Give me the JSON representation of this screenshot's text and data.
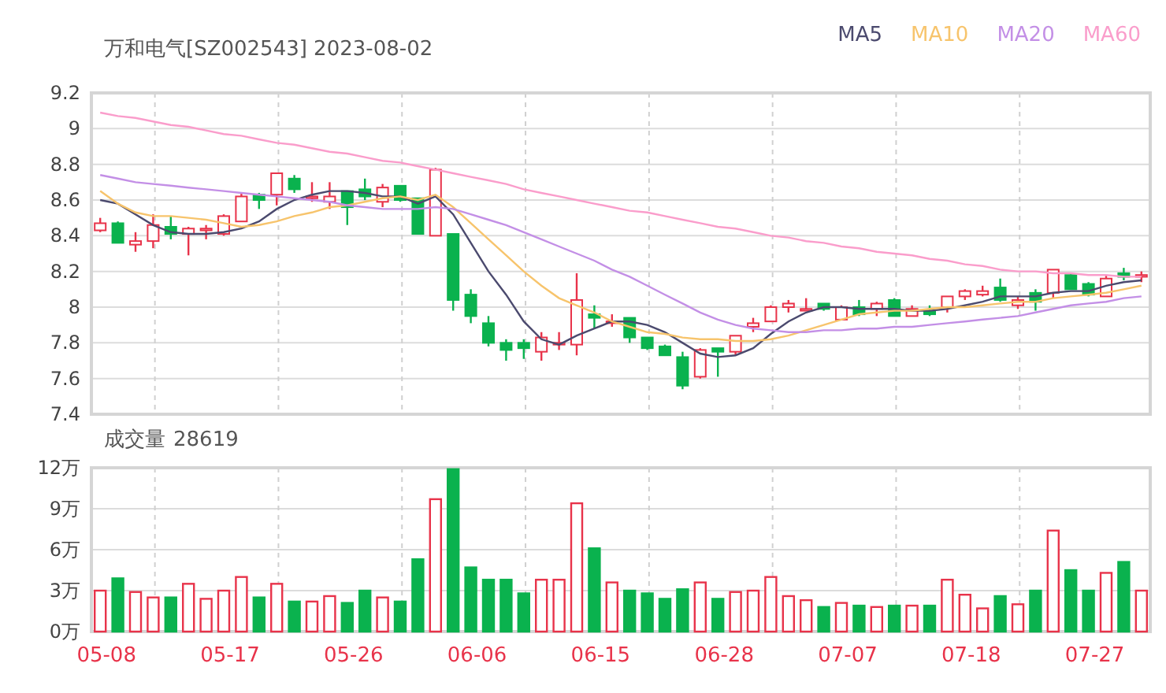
{
  "header": {
    "title": "万和电气[SZ002543] 2023-08-02"
  },
  "price_chart": {
    "chart_data": {
      "type": "line",
      "grid": true,
      "ylim": [
        7.4,
        9.2
      ],
      "yticks": [
        7.4,
        7.6,
        7.8,
        8,
        8.2,
        8.4,
        8.6,
        8.8,
        9,
        9.2
      ],
      "series": [
        {
          "name": "MA5",
          "color": "#4b4a6e",
          "values": [
            8.6,
            8.58,
            8.52,
            8.46,
            8.42,
            8.41,
            8.41,
            8.42,
            8.44,
            8.48,
            8.55,
            8.6,
            8.63,
            8.65,
            8.65,
            8.64,
            8.62,
            8.62,
            8.58,
            8.62,
            8.52,
            8.36,
            8.2,
            8.07,
            7.92,
            7.82,
            7.79,
            7.84,
            7.88,
            7.92,
            7.92,
            7.9,
            7.86,
            7.8,
            7.74,
            7.72,
            7.73,
            7.77,
            7.85,
            7.92,
            7.97,
            8,
            8,
            7.99,
            7.99,
            7.99,
            7.98,
            7.98,
            7.99,
            8.01,
            8.03,
            8.06,
            8.06,
            8.06,
            8.08,
            8.09,
            8.09,
            8.12,
            8.14,
            8.15
          ]
        },
        {
          "name": "MA10",
          "color": "#f7c46c",
          "values": [
            8.65,
            8.58,
            8.53,
            8.51,
            8.51,
            8.5,
            8.49,
            8.47,
            8.45,
            8.46,
            8.48,
            8.51,
            8.53,
            8.56,
            8.57,
            8.59,
            8.61,
            8.62,
            8.6,
            8.63,
            8.56,
            8.47,
            8.38,
            8.29,
            8.2,
            8.12,
            8.05,
            8.01,
            7.97,
            7.92,
            7.89,
            7.86,
            7.85,
            7.83,
            7.82,
            7.82,
            7.81,
            7.81,
            7.82,
            7.84,
            7.87,
            7.9,
            7.93,
            7.96,
            7.97,
            7.98,
            7.98,
            7.99,
            8,
            8,
            8.01,
            8.02,
            8.03,
            8.03,
            8.05,
            8.06,
            8.07,
            8.08,
            8.1,
            8.12
          ]
        },
        {
          "name": "MA20",
          "color": "#c38fe6",
          "values": [
            8.74,
            8.72,
            8.7,
            8.69,
            8.68,
            8.67,
            8.66,
            8.65,
            8.64,
            8.63,
            8.62,
            8.61,
            8.6,
            8.59,
            8.57,
            8.56,
            8.55,
            8.55,
            8.55,
            8.56,
            8.55,
            8.52,
            8.49,
            8.46,
            8.42,
            8.38,
            8.34,
            8.3,
            8.26,
            8.21,
            8.17,
            8.12,
            8.07,
            8.02,
            7.97,
            7.93,
            7.9,
            7.88,
            7.87,
            7.86,
            7.86,
            7.87,
            7.87,
            7.88,
            7.88,
            7.89,
            7.89,
            7.9,
            7.91,
            7.92,
            7.93,
            7.94,
            7.95,
            7.97,
            7.99,
            8.01,
            8.02,
            8.03,
            8.05,
            8.06
          ]
        },
        {
          "name": "MA60",
          "color": "#fa9dcb",
          "values": [
            9.09,
            9.07,
            9.06,
            9.04,
            9.02,
            9.01,
            8.99,
            8.97,
            8.96,
            8.94,
            8.92,
            8.91,
            8.89,
            8.87,
            8.86,
            8.84,
            8.82,
            8.81,
            8.79,
            8.77,
            8.75,
            8.73,
            8.71,
            8.69,
            8.66,
            8.64,
            8.62,
            8.6,
            8.58,
            8.56,
            8.54,
            8.53,
            8.51,
            8.49,
            8.47,
            8.45,
            8.44,
            8.42,
            8.4,
            8.39,
            8.37,
            8.36,
            8.34,
            8.33,
            8.31,
            8.3,
            8.29,
            8.27,
            8.26,
            8.24,
            8.23,
            8.21,
            8.2,
            8.2,
            8.19,
            8.19,
            8.18,
            8.18,
            8.17,
            8.17
          ]
        },
        {
          "type": "candlestick",
          "ohlc": [
            [
              8.43,
              8.5,
              8.42,
              8.47
            ],
            [
              8.47,
              8.48,
              8.36,
              8.36
            ],
            [
              8.35,
              8.42,
              8.31,
              8.37
            ],
            [
              8.37,
              8.52,
              8.33,
              8.46
            ],
            [
              8.45,
              8.51,
              8.38,
              8.41
            ],
            [
              8.41,
              8.45,
              8.29,
              8.44
            ],
            [
              8.43,
              8.46,
              8.38,
              8.44
            ],
            [
              8.41,
              8.52,
              8.4,
              8.51
            ],
            [
              8.48,
              8.64,
              8.48,
              8.62
            ],
            [
              8.63,
              8.64,
              8.55,
              8.6
            ],
            [
              8.63,
              8.75,
              8.57,
              8.75
            ],
            [
              8.72,
              8.74,
              8.64,
              8.66
            ],
            [
              8.61,
              8.7,
              8.59,
              8.62
            ],
            [
              8.59,
              8.7,
              8.55,
              8.62
            ],
            [
              8.65,
              8.65,
              8.46,
              8.56
            ],
            [
              8.66,
              8.72,
              8.6,
              8.62
            ],
            [
              8.59,
              8.69,
              8.56,
              8.67
            ],
            [
              8.68,
              8.68,
              8.59,
              8.6
            ],
            [
              8.61,
              8.61,
              8.41,
              8.41
            ],
            [
              8.4,
              8.78,
              8.4,
              8.77
            ],
            [
              8.41,
              8.41,
              7.98,
              8.04
            ],
            [
              8.07,
              8.1,
              7.91,
              7.95
            ],
            [
              7.91,
              7.95,
              7.78,
              7.8
            ],
            [
              7.8,
              7.82,
              7.7,
              7.76
            ],
            [
              7.8,
              7.82,
              7.71,
              7.77
            ],
            [
              7.75,
              7.86,
              7.7,
              7.83
            ],
            [
              7.79,
              7.86,
              7.76,
              7.8
            ],
            [
              7.79,
              8.19,
              7.73,
              8.04
            ],
            [
              7.96,
              8.01,
              7.88,
              7.94
            ],
            [
              7.91,
              7.96,
              7.89,
              7.92
            ],
            [
              7.94,
              7.94,
              7.8,
              7.83
            ],
            [
              7.83,
              7.83,
              7.76,
              7.77
            ],
            [
              7.78,
              7.79,
              7.73,
              7.73
            ],
            [
              7.72,
              7.75,
              7.54,
              7.56
            ],
            [
              7.61,
              7.77,
              7.6,
              7.76
            ],
            [
              7.77,
              7.77,
              7.61,
              7.75
            ],
            [
              7.75,
              7.84,
              7.73,
              7.84
            ],
            [
              7.89,
              7.94,
              7.86,
              7.91
            ],
            [
              7.92,
              8.01,
              7.92,
              8
            ],
            [
              8,
              8.04,
              7.97,
              8.02
            ],
            [
              7.98,
              8.05,
              7.98,
              7.99
            ],
            [
              8.02,
              8.02,
              7.98,
              7.99
            ],
            [
              7.93,
              8.01,
              7.93,
              8
            ],
            [
              8,
              8.04,
              7.95,
              7.96
            ],
            [
              7.99,
              8.03,
              7.95,
              8.02
            ],
            [
              8.04,
              8.05,
              7.95,
              7.95
            ],
            [
              7.95,
              8.01,
              7.95,
              7.99
            ],
            [
              7.98,
              8.01,
              7.95,
              7.96
            ],
            [
              8,
              8.06,
              7.97,
              8.06
            ],
            [
              8.06,
              8.1,
              8.04,
              8.09
            ],
            [
              8.07,
              8.12,
              8.06,
              8.09
            ],
            [
              8.11,
              8.16,
              8.03,
              8.04
            ],
            [
              8.01,
              8.06,
              7.99,
              8.04
            ],
            [
              8.08,
              8.1,
              7.98,
              8.03
            ],
            [
              8.08,
              8.21,
              8.05,
              8.21
            ],
            [
              8.18,
              8.19,
              8.1,
              8.1
            ],
            [
              8.13,
              8.14,
              8.06,
              8.07
            ],
            [
              8.06,
              8.18,
              8.06,
              8.16
            ],
            [
              8.19,
              8.22,
              8.15,
              8.17
            ],
            [
              8.17,
              8.2,
              8.14,
              8.18
            ]
          ]
        }
      ]
    }
  },
  "volume_chart": {
    "latest_volume": "28619",
    "chart_data": {
      "type": "bar",
      "grid": true,
      "ylim": [
        0,
        12
      ],
      "categories": [
        "05-08",
        null,
        null,
        null,
        null,
        null,
        null,
        "05-17",
        null,
        null,
        null,
        null,
        null,
        null,
        "05-26",
        null,
        null,
        null,
        null,
        null,
        null,
        "06-06",
        null,
        null,
        null,
        null,
        null,
        null,
        "06-15",
        null,
        null,
        null,
        null,
        null,
        null,
        "06-28",
        null,
        null,
        null,
        null,
        null,
        null,
        "07-07",
        null,
        null,
        null,
        null,
        null,
        null,
        "07-18",
        null,
        null,
        null,
        null,
        null,
        null,
        "07-27",
        null,
        null,
        null
      ],
      "yticks": [
        {
          "value": 0,
          "label": "0万"
        },
        {
          "value": 3,
          "label": "3万"
        },
        {
          "value": 6,
          "label": "6万"
        },
        {
          "value": 9,
          "label": "9万"
        },
        {
          "value": 12,
          "label": "12万"
        }
      ],
      "series": [
        {
          "name": "成交量",
          "values": [
            3,
            3.9,
            2.9,
            2.5,
            2.5,
            3.5,
            2.4,
            3,
            4,
            2.5,
            3.5,
            2.2,
            2.2,
            2.6,
            2.1,
            3,
            2.5,
            2.2,
            5.3,
            9.7,
            11.9,
            4.7,
            3.8,
            3.8,
            2.8,
            3.8,
            3.8,
            9.4,
            6.1,
            3.6,
            3,
            2.8,
            2.4,
            3.1,
            3.6,
            2.4,
            2.9,
            3,
            4,
            2.6,
            2.3,
            1.8,
            2.1,
            1.9,
            1.8,
            1.9,
            1.9,
            1.9,
            3.8,
            2.7,
            1.7,
            2.6,
            2,
            3,
            7.4,
            4.5,
            3,
            4.3,
            5.1,
            3
          ]
        }
      ]
    }
  }
}
